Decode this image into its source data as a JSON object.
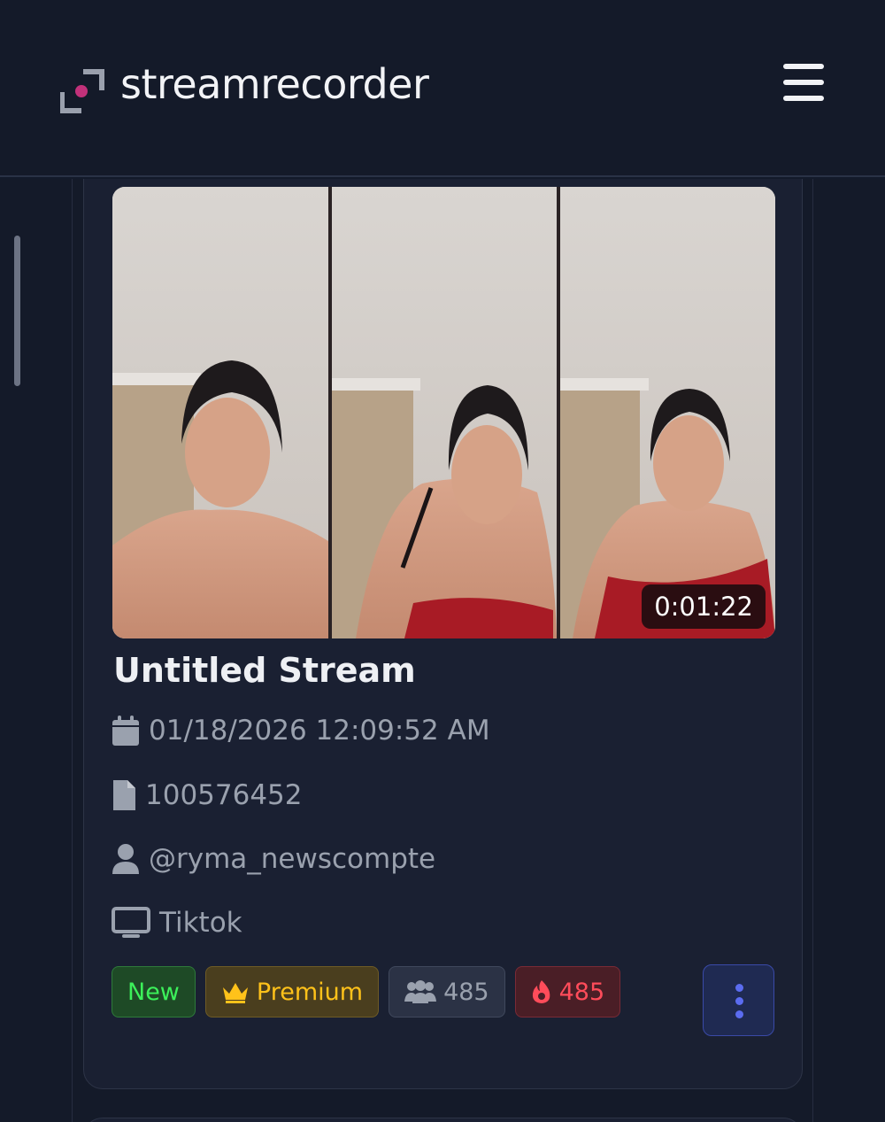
{
  "header": {
    "brand": "streamrecorder",
    "menu_icon": "hamburger-menu-icon",
    "logo_icon": "streamrecorder-logo-icon",
    "logo_dot_color": "#c2317a"
  },
  "card": {
    "title": "Untitled Stream",
    "duration": "0:01:22",
    "date": "01/18/2026 12:09:52 AM",
    "file_id": "100576452",
    "username": "@ryma_newscompte",
    "platform": "Tiktok",
    "tags": {
      "new": "New",
      "premium": "Premium",
      "viewers": "485",
      "hot": "485"
    },
    "icons": {
      "date": "calendar-icon",
      "file": "file-icon",
      "user": "user-icon",
      "platform": "monitor-icon",
      "premium": "crown-icon",
      "viewers": "users-icon",
      "hot": "fire-icon",
      "more": "vertical-dots-icon"
    }
  }
}
